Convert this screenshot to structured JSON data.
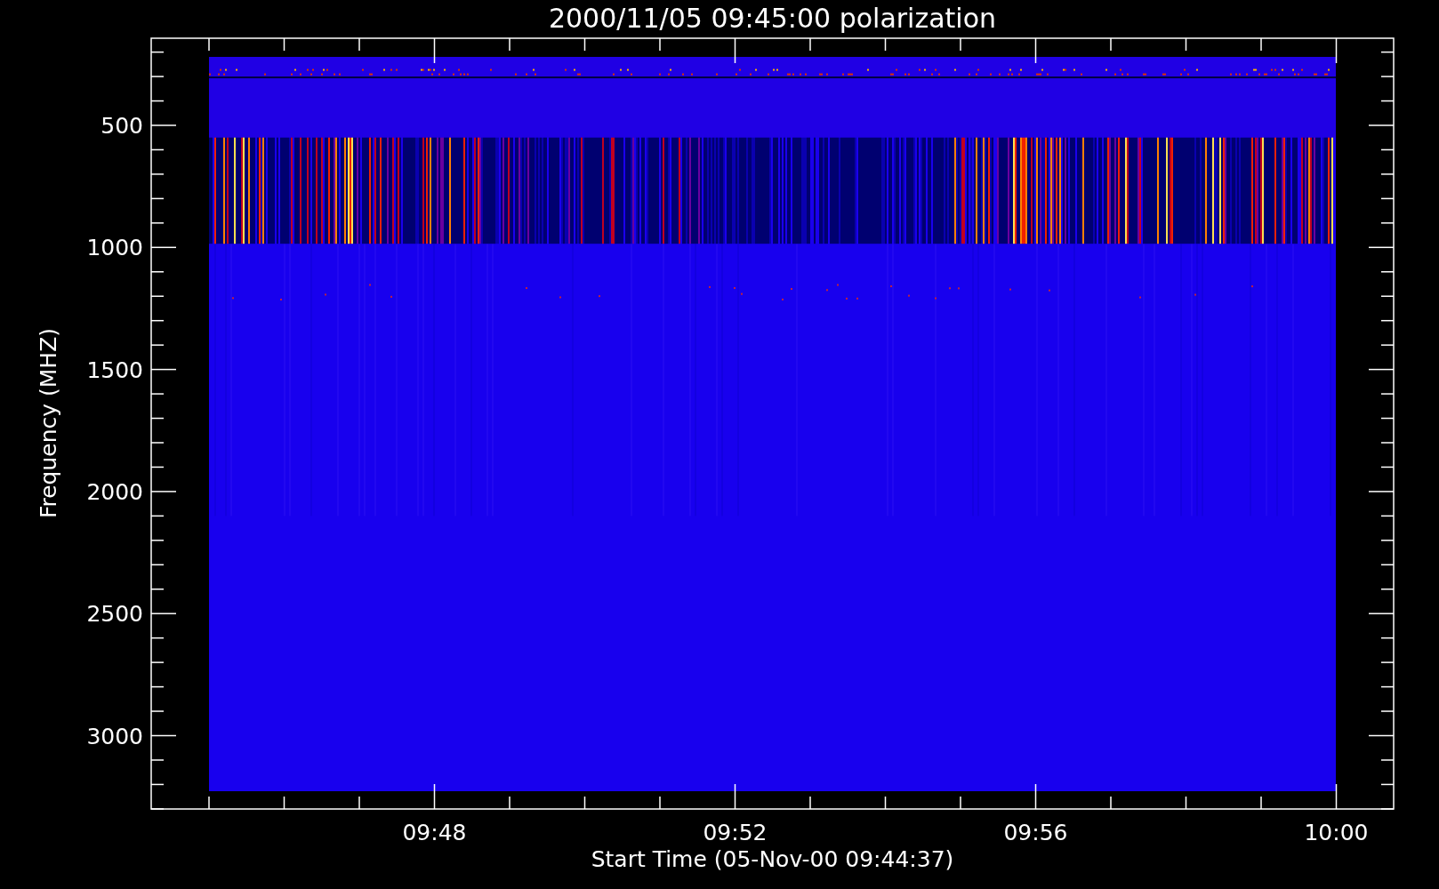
{
  "title": "2000/11/05 09:45:00 polarization",
  "y_axis": {
    "label": "Frequency (MHZ)",
    "ticks": [
      "500",
      "1000",
      "1500",
      "2000",
      "2500",
      "3000"
    ]
  },
  "x_axis": {
    "label": "Start Time (05-Nov-00 09:44:37)",
    "ticks": [
      "09:48",
      "09:52",
      "09:56",
      "10:00"
    ]
  }
}
